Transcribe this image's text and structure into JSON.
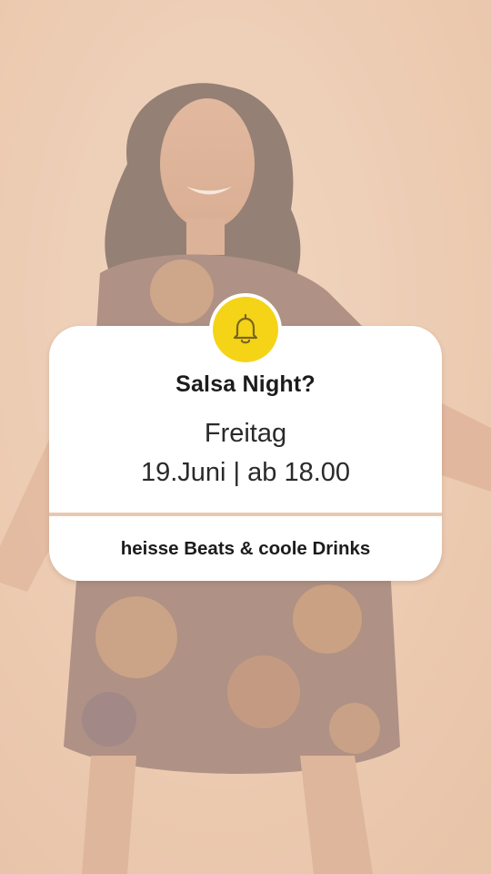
{
  "card": {
    "title": "Salsa Night?",
    "day": "Freitag",
    "datetime": "19.Juni | ab 18.00",
    "tagline": "heisse Beats & coole Drinks"
  },
  "icons": {
    "badge": "bell-icon"
  },
  "colors": {
    "background": "#e9c8ad",
    "card": "#ffffff",
    "badge": "#f5d417",
    "divider": "#e8c9b0",
    "text": "#1c1c1c"
  }
}
